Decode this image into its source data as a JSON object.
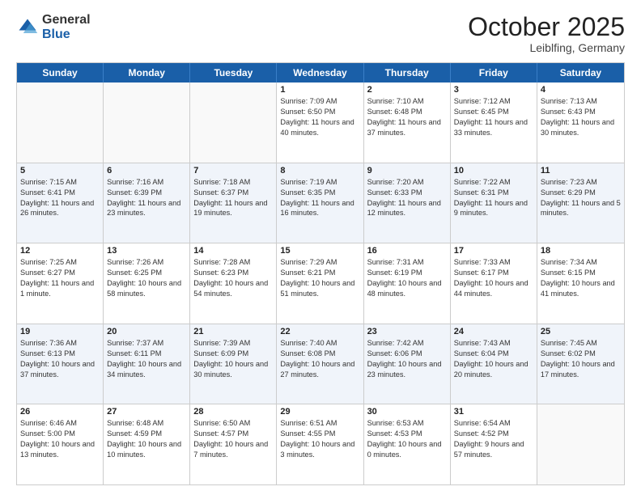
{
  "header": {
    "logo_general": "General",
    "logo_blue": "Blue",
    "month_title": "October 2025",
    "location": "Leiblfing, Germany"
  },
  "weekdays": [
    "Sunday",
    "Monday",
    "Tuesday",
    "Wednesday",
    "Thursday",
    "Friday",
    "Saturday"
  ],
  "rows": [
    {
      "alt": false,
      "cells": [
        {
          "day": "",
          "info": ""
        },
        {
          "day": "",
          "info": ""
        },
        {
          "day": "",
          "info": ""
        },
        {
          "day": "1",
          "info": "Sunrise: 7:09 AM\nSunset: 6:50 PM\nDaylight: 11 hours and 40 minutes."
        },
        {
          "day": "2",
          "info": "Sunrise: 7:10 AM\nSunset: 6:48 PM\nDaylight: 11 hours and 37 minutes."
        },
        {
          "day": "3",
          "info": "Sunrise: 7:12 AM\nSunset: 6:45 PM\nDaylight: 11 hours and 33 minutes."
        },
        {
          "day": "4",
          "info": "Sunrise: 7:13 AM\nSunset: 6:43 PM\nDaylight: 11 hours and 30 minutes."
        }
      ]
    },
    {
      "alt": true,
      "cells": [
        {
          "day": "5",
          "info": "Sunrise: 7:15 AM\nSunset: 6:41 PM\nDaylight: 11 hours and 26 minutes."
        },
        {
          "day": "6",
          "info": "Sunrise: 7:16 AM\nSunset: 6:39 PM\nDaylight: 11 hours and 23 minutes."
        },
        {
          "day": "7",
          "info": "Sunrise: 7:18 AM\nSunset: 6:37 PM\nDaylight: 11 hours and 19 minutes."
        },
        {
          "day": "8",
          "info": "Sunrise: 7:19 AM\nSunset: 6:35 PM\nDaylight: 11 hours and 16 minutes."
        },
        {
          "day": "9",
          "info": "Sunrise: 7:20 AM\nSunset: 6:33 PM\nDaylight: 11 hours and 12 minutes."
        },
        {
          "day": "10",
          "info": "Sunrise: 7:22 AM\nSunset: 6:31 PM\nDaylight: 11 hours and 9 minutes."
        },
        {
          "day": "11",
          "info": "Sunrise: 7:23 AM\nSunset: 6:29 PM\nDaylight: 11 hours and 5 minutes."
        }
      ]
    },
    {
      "alt": false,
      "cells": [
        {
          "day": "12",
          "info": "Sunrise: 7:25 AM\nSunset: 6:27 PM\nDaylight: 11 hours and 1 minute."
        },
        {
          "day": "13",
          "info": "Sunrise: 7:26 AM\nSunset: 6:25 PM\nDaylight: 10 hours and 58 minutes."
        },
        {
          "day": "14",
          "info": "Sunrise: 7:28 AM\nSunset: 6:23 PM\nDaylight: 10 hours and 54 minutes."
        },
        {
          "day": "15",
          "info": "Sunrise: 7:29 AM\nSunset: 6:21 PM\nDaylight: 10 hours and 51 minutes."
        },
        {
          "day": "16",
          "info": "Sunrise: 7:31 AM\nSunset: 6:19 PM\nDaylight: 10 hours and 48 minutes."
        },
        {
          "day": "17",
          "info": "Sunrise: 7:33 AM\nSunset: 6:17 PM\nDaylight: 10 hours and 44 minutes."
        },
        {
          "day": "18",
          "info": "Sunrise: 7:34 AM\nSunset: 6:15 PM\nDaylight: 10 hours and 41 minutes."
        }
      ]
    },
    {
      "alt": true,
      "cells": [
        {
          "day": "19",
          "info": "Sunrise: 7:36 AM\nSunset: 6:13 PM\nDaylight: 10 hours and 37 minutes."
        },
        {
          "day": "20",
          "info": "Sunrise: 7:37 AM\nSunset: 6:11 PM\nDaylight: 10 hours and 34 minutes."
        },
        {
          "day": "21",
          "info": "Sunrise: 7:39 AM\nSunset: 6:09 PM\nDaylight: 10 hours and 30 minutes."
        },
        {
          "day": "22",
          "info": "Sunrise: 7:40 AM\nSunset: 6:08 PM\nDaylight: 10 hours and 27 minutes."
        },
        {
          "day": "23",
          "info": "Sunrise: 7:42 AM\nSunset: 6:06 PM\nDaylight: 10 hours and 23 minutes."
        },
        {
          "day": "24",
          "info": "Sunrise: 7:43 AM\nSunset: 6:04 PM\nDaylight: 10 hours and 20 minutes."
        },
        {
          "day": "25",
          "info": "Sunrise: 7:45 AM\nSunset: 6:02 PM\nDaylight: 10 hours and 17 minutes."
        }
      ]
    },
    {
      "alt": false,
      "cells": [
        {
          "day": "26",
          "info": "Sunrise: 6:46 AM\nSunset: 5:00 PM\nDaylight: 10 hours and 13 minutes."
        },
        {
          "day": "27",
          "info": "Sunrise: 6:48 AM\nSunset: 4:59 PM\nDaylight: 10 hours and 10 minutes."
        },
        {
          "day": "28",
          "info": "Sunrise: 6:50 AM\nSunset: 4:57 PM\nDaylight: 10 hours and 7 minutes."
        },
        {
          "day": "29",
          "info": "Sunrise: 6:51 AM\nSunset: 4:55 PM\nDaylight: 10 hours and 3 minutes."
        },
        {
          "day": "30",
          "info": "Sunrise: 6:53 AM\nSunset: 4:53 PM\nDaylight: 10 hours and 0 minutes."
        },
        {
          "day": "31",
          "info": "Sunrise: 6:54 AM\nSunset: 4:52 PM\nDaylight: 9 hours and 57 minutes."
        },
        {
          "day": "",
          "info": ""
        }
      ]
    }
  ]
}
